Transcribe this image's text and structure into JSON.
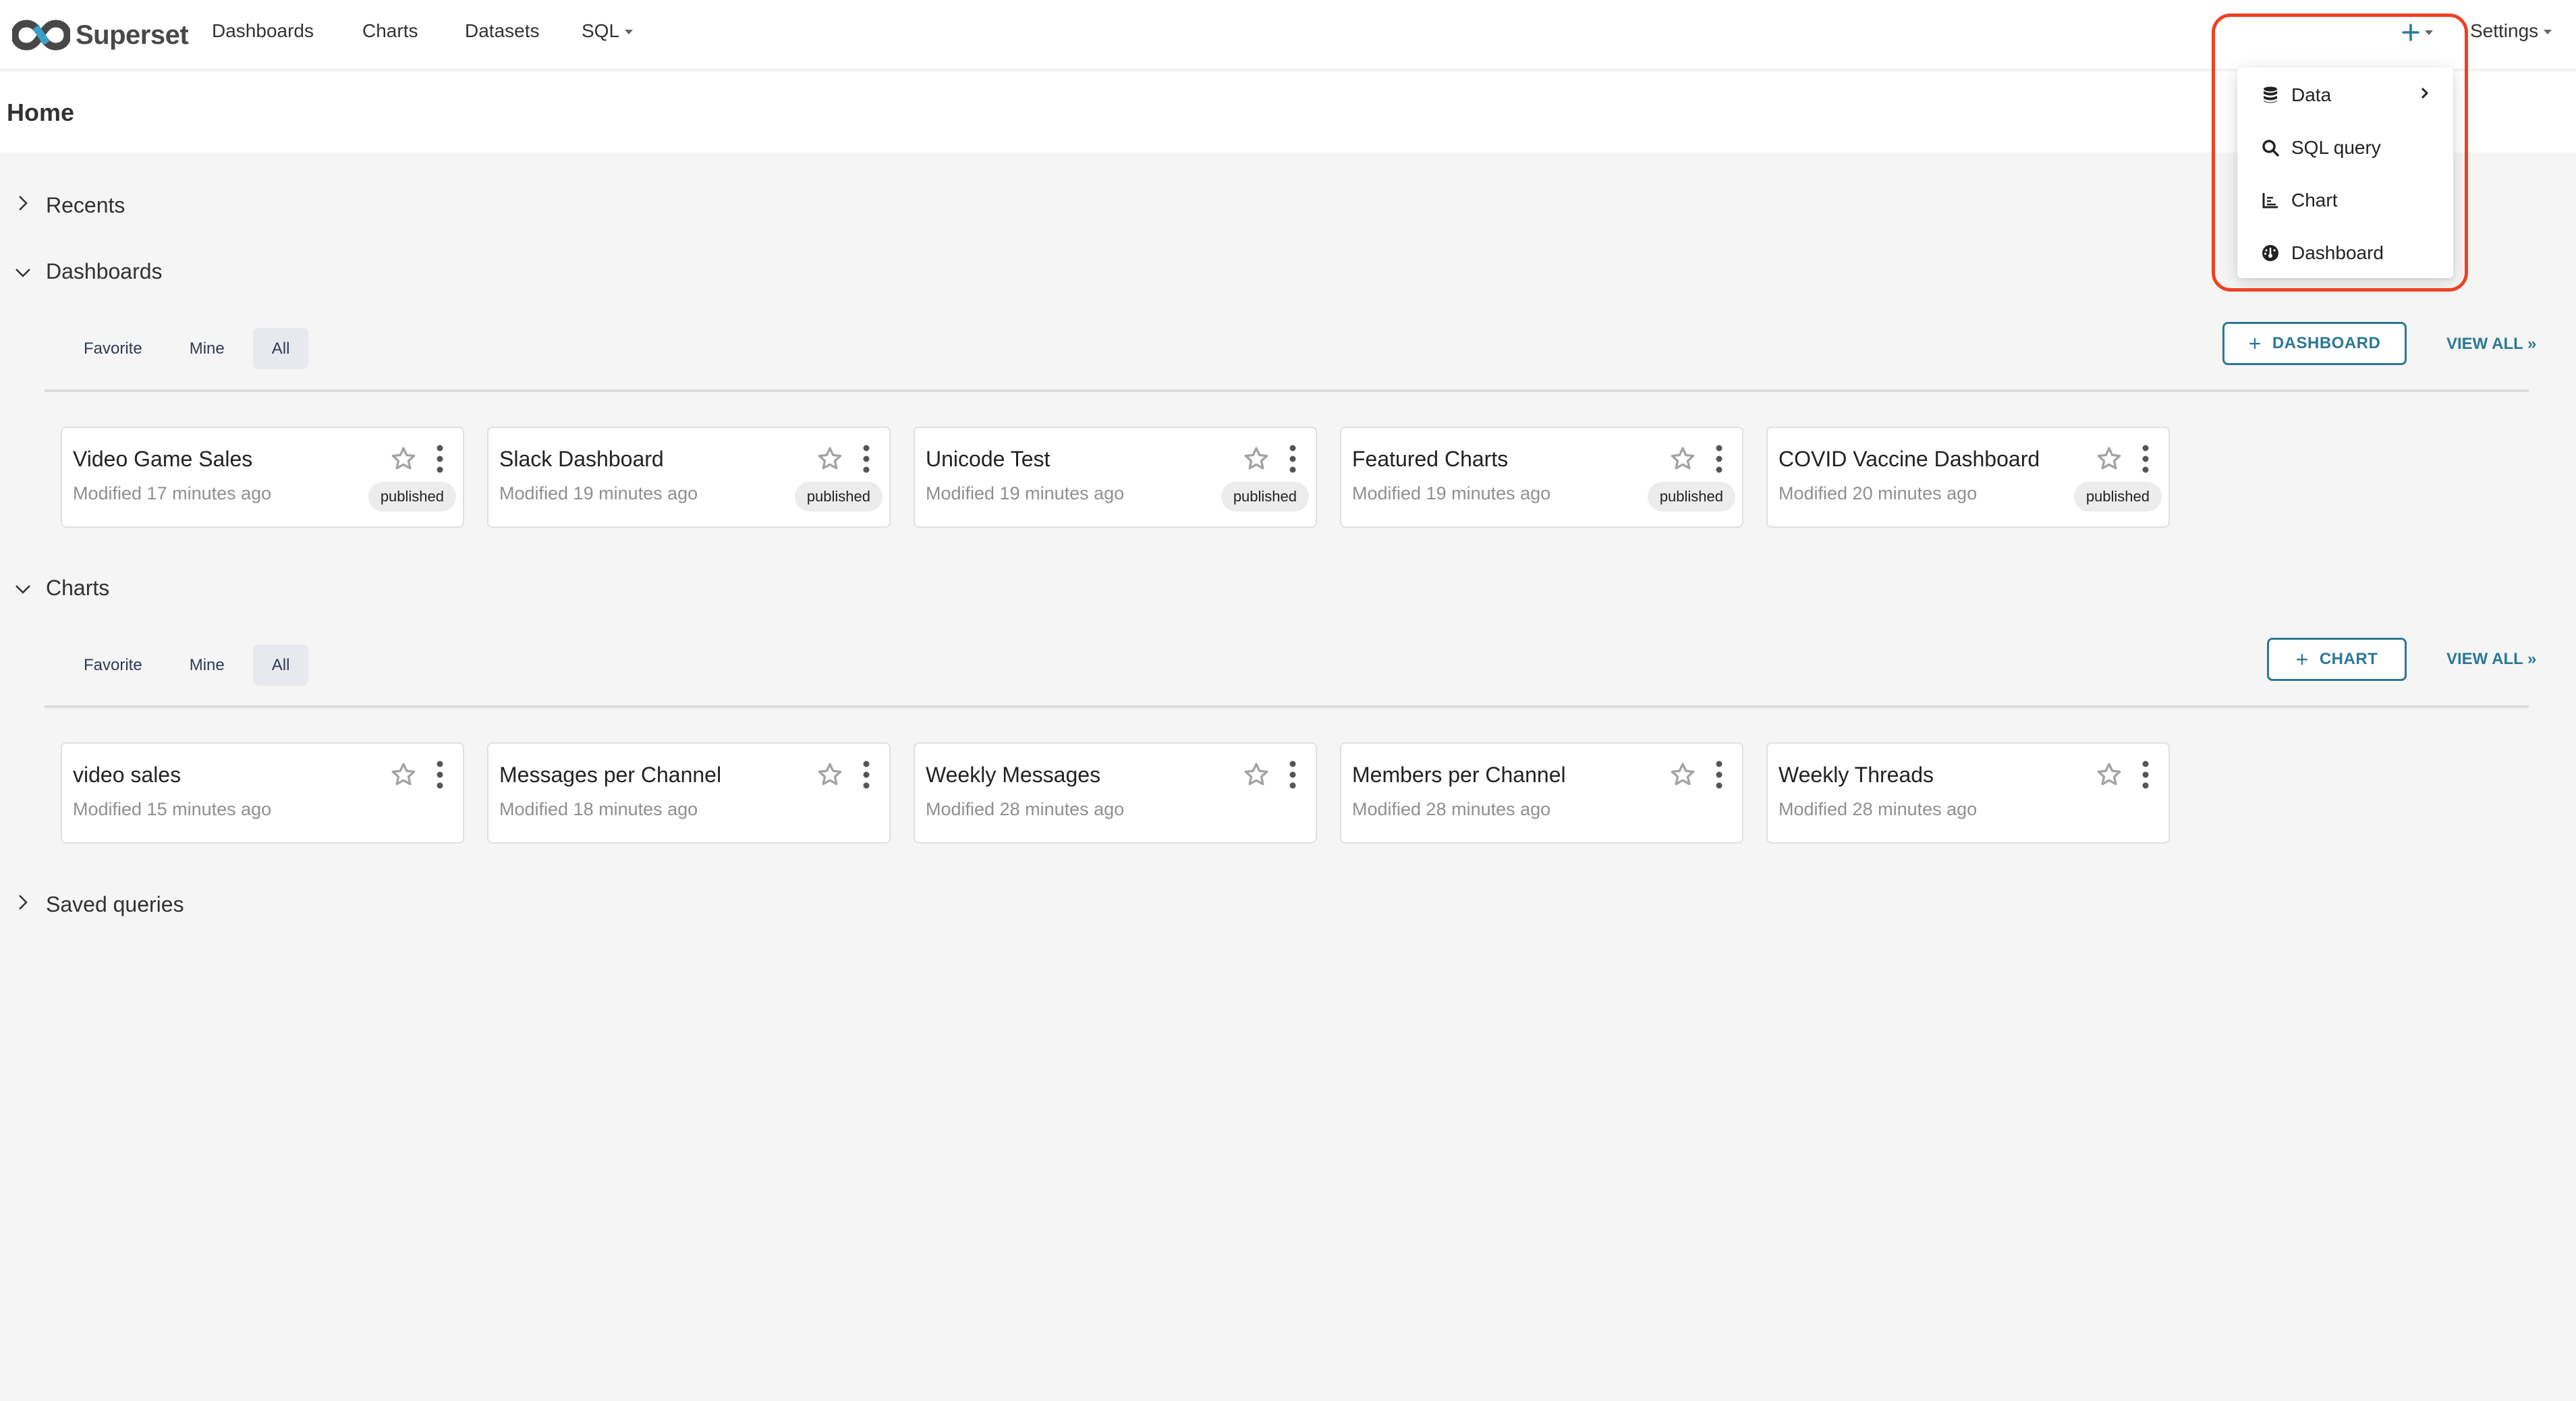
{
  "nav": {
    "brand": "Superset",
    "items": [
      {
        "label": "Dashboards"
      },
      {
        "label": "Charts"
      },
      {
        "label": "Datasets"
      },
      {
        "label": "SQL",
        "has_caret": true
      }
    ],
    "plus_icon": "plus-icon",
    "settings_label": "Settings"
  },
  "new_menu": {
    "items": [
      {
        "label": "Data",
        "icon": "database-icon",
        "submenu_indicator": "›"
      },
      {
        "label": "SQL query",
        "icon": "search-icon"
      },
      {
        "label": "Chart",
        "icon": "bar-chart-icon"
      },
      {
        "label": "Dashboard",
        "icon": "dashboard-gauge-icon"
      }
    ]
  },
  "page": {
    "title": "Home"
  },
  "sections": {
    "recents": {
      "label": "Recents",
      "expanded": false
    },
    "dashboards": {
      "label": "Dashboards",
      "expanded": true,
      "tabs": [
        "Favorite",
        "Mine",
        "All"
      ],
      "active_tab": "All",
      "add_button": "DASHBOARD",
      "view_all": "VIEW ALL »",
      "cards": [
        {
          "title": "Video Game Sales",
          "modified": "Modified 17 minutes ago",
          "status": "published"
        },
        {
          "title": "Slack Dashboard",
          "modified": "Modified 19 minutes ago",
          "status": "published"
        },
        {
          "title": "Unicode Test",
          "modified": "Modified 19 minutes ago",
          "status": "published"
        },
        {
          "title": "Featured Charts",
          "modified": "Modified 19 minutes ago",
          "status": "published"
        },
        {
          "title": "COVID Vaccine Dashboard",
          "modified": "Modified 20 minutes ago",
          "status": "published"
        }
      ]
    },
    "charts": {
      "label": "Charts",
      "expanded": true,
      "tabs": [
        "Favorite",
        "Mine",
        "All"
      ],
      "active_tab": "All",
      "add_button": "CHART",
      "view_all": "VIEW ALL »",
      "cards": [
        {
          "title": "video sales",
          "modified": "Modified 15 minutes ago"
        },
        {
          "title": "Messages per Channel",
          "modified": "Modified 18 minutes ago"
        },
        {
          "title": "Weekly Messages",
          "modified": "Modified 28 minutes ago"
        },
        {
          "title": "Members per Channel",
          "modified": "Modified 28 minutes ago"
        },
        {
          "title": "Weekly Threads",
          "modified": "Modified 28 minutes ago"
        }
      ]
    },
    "saved_queries": {
      "label": "Saved queries",
      "expanded": false
    }
  },
  "colors": {
    "primary": "#2b7896",
    "highlight": "#ee4123",
    "background": "#f5f5f5",
    "logo_accent": "#3aa0c9",
    "logo_dark": "#484848"
  }
}
